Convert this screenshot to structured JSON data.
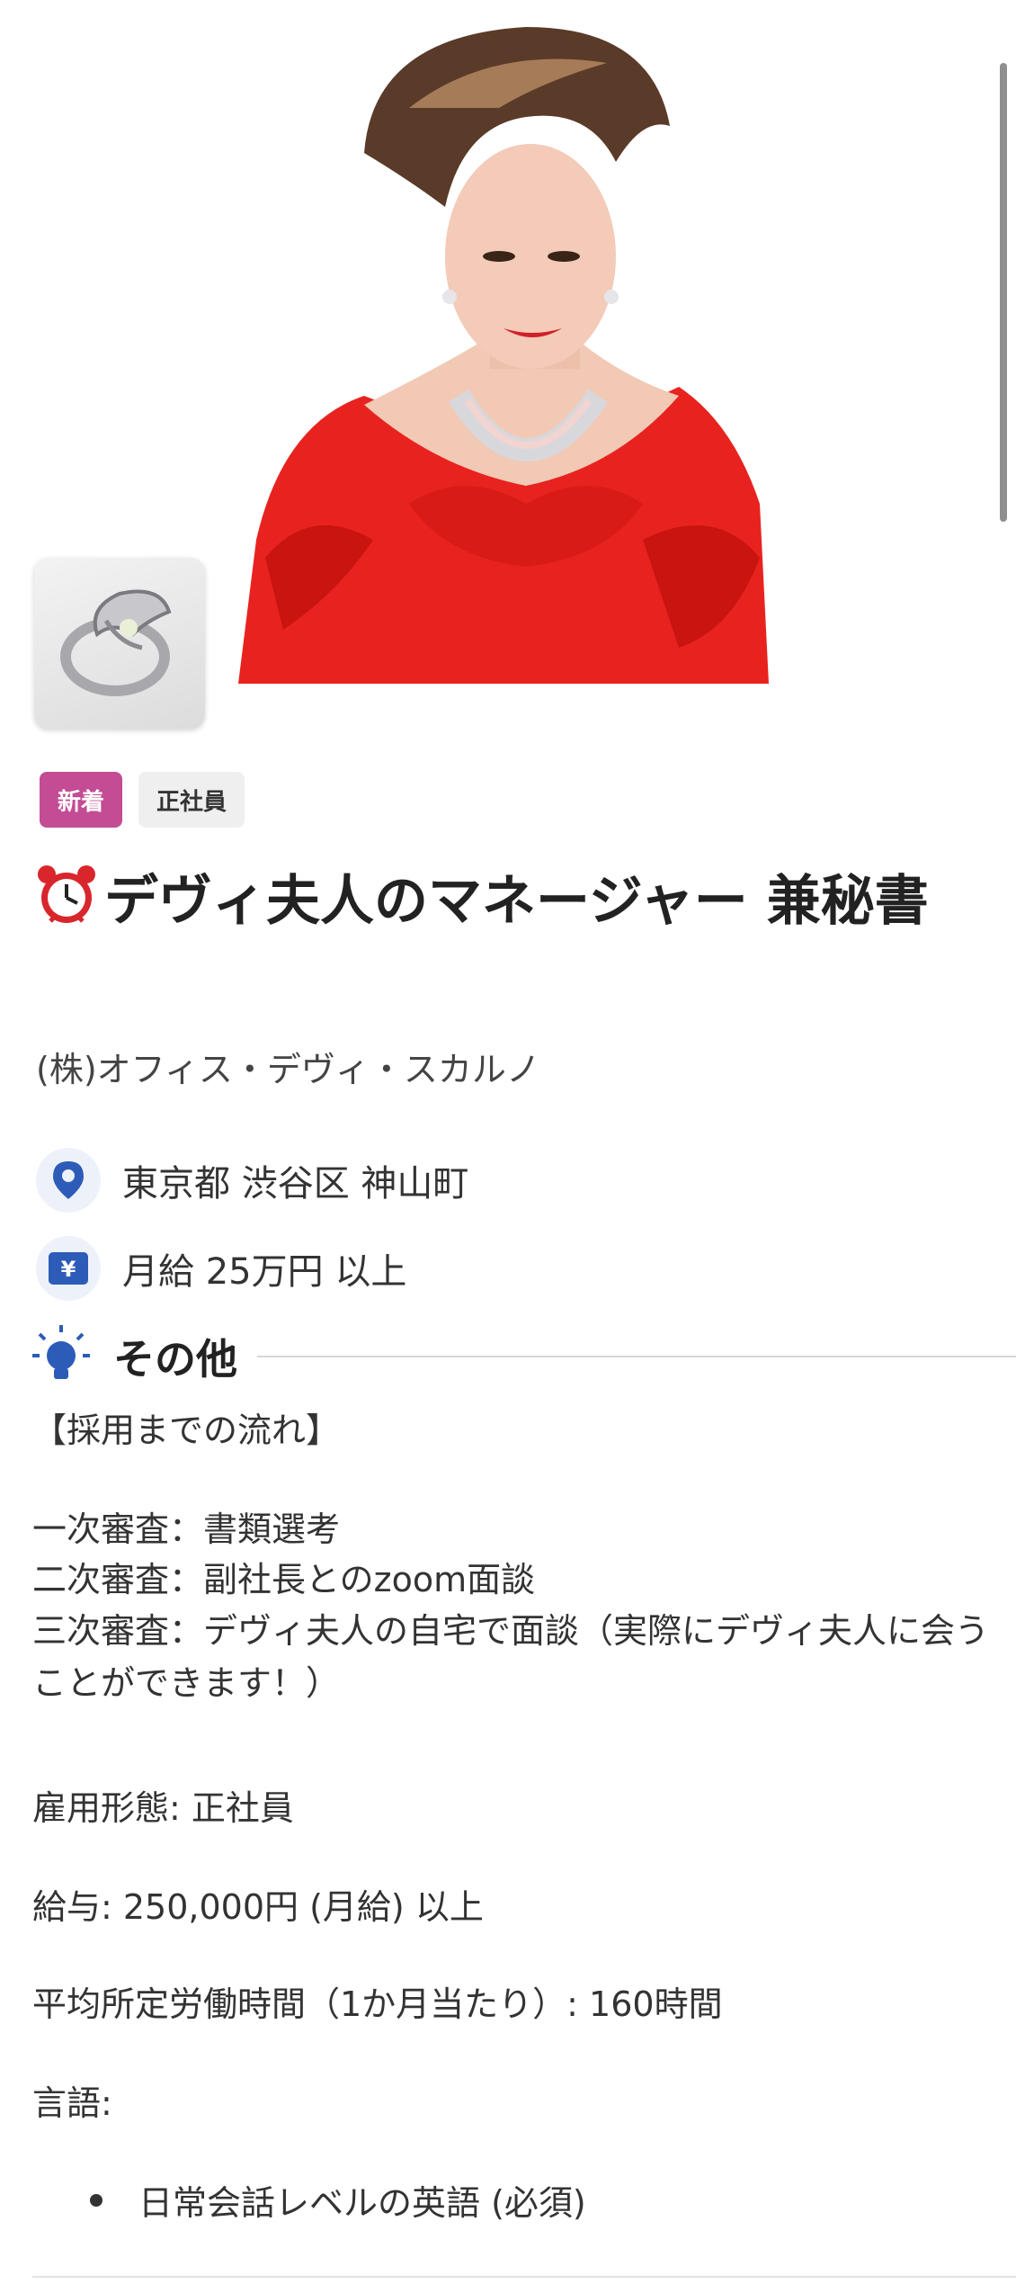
{
  "badges": {
    "new": "新着",
    "employment": "正社員"
  },
  "job": {
    "title": "デヴィ夫人のマネージャー 兼秘書",
    "company": "(株)オフィス・デヴィ・スカルノ",
    "location": "東京都 渋谷区 神山町",
    "salary": "月給 25万円 以上"
  },
  "section": {
    "title": "その他"
  },
  "details": {
    "process_heading": "【採用までの流れ】",
    "step1": "一次審査：書類選考",
    "step2": "二次審査：副社長とのzoom面談",
    "step3": "三次審査：デヴィ夫人の自宅で面談（実際にデヴィ夫人に会うことができます！）",
    "employment_type": "雇用形態: 正社員",
    "salary": "給与: 250,000円 (月給) 以上",
    "hours": "平均所定労働時間（1か月当たり）: 160時間",
    "language_label": "言語:",
    "language_item": "日常会話レベルの英語 (必須)"
  },
  "icons": {
    "title_prefix": "alarm-clock-icon",
    "location": "location-pin-icon",
    "salary": "yen-icon",
    "section": "lightbulb-icon"
  },
  "colors": {
    "badge_new": "#c34c94",
    "accent_blue": "#2d5cb8",
    "dress_red": "#e8231f"
  }
}
